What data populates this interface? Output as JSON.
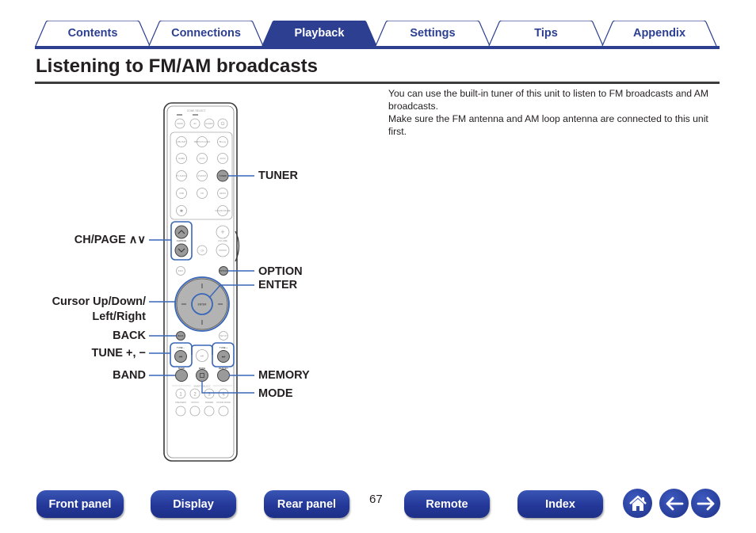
{
  "tabs": [
    {
      "label": "Contents",
      "active": false
    },
    {
      "label": "Connections",
      "active": false
    },
    {
      "label": "Playback",
      "active": true
    },
    {
      "label": "Settings",
      "active": false
    },
    {
      "label": "Tips",
      "active": false
    },
    {
      "label": "Appendix",
      "active": false
    }
  ],
  "page": {
    "title": "Listening to FM/AM broadcasts",
    "intro": [
      "You can use the built-in tuner of this unit to listen to FM broadcasts and AM broadcasts.",
      "Make sure the FM antenna and AM loop antenna are connected to this unit first."
    ],
    "number": "67"
  },
  "remote": {
    "callouts_left": {
      "ch_page": "CH/PAGE ∧∨",
      "cursor_line1": "Cursor Up/Down/",
      "cursor_line2": "Left/Right",
      "back": "BACK",
      "tune": "TUNE +, −",
      "band": "BAND"
    },
    "callouts_right": {
      "tuner": "TUNER",
      "option": "OPTION",
      "enter": "ENTER",
      "memory": "MEMORY",
      "mode": "MODE"
    },
    "small_labels": {
      "zone_select": "ZONE SELECT",
      "main": "MAIN",
      "z2": "Z2",
      "sleep": "SLEEP",
      "cbl_sat": "CBL/SAT",
      "media_player": "MEDIA PLAYER",
      "bluray": "Blu-ray",
      "game": "GAME",
      "aux1": "AUX1",
      "aux2": "AUX2",
      "tv_audio": "TV AUDIO",
      "phono": "PHONO",
      "tuner": "TUNER",
      "usb": "USB",
      "cd": "CD",
      "heos": "HEOS",
      "bluetooth": "✱",
      "sound_mode": "SOUND MODE",
      "ch_page": "CH/PAGE",
      "volume": "VOLUME",
      "mute": "◁×",
      "info": "INFO",
      "option": "OPTION",
      "enter": "ENTER",
      "back": "BACK",
      "setup": "SETUP",
      "tune_minus": "TUNE −",
      "tune_plus": "TUNE +",
      "band": "BAND",
      "mode": "MODE",
      "memory": "MEMORY",
      "smart_select": "SMART SELECT",
      "speakers": "SPEAKERS",
      "status": "STATUS",
      "dimmer": "DIMMER",
      "sound_mode2": "SOUND MODE",
      "one": "1",
      "two": "2",
      "three": "3",
      "four": "4"
    }
  },
  "bottom_nav": {
    "front_panel": "Front panel",
    "display": "Display",
    "rear_panel": "Rear panel",
    "remote": "Remote",
    "index": "Index",
    "home_icon": "home-icon",
    "back_icon": "arrow-left-icon",
    "forward_icon": "arrow-right-icon"
  },
  "colors": {
    "brand_blue": "#2c3f91",
    "callout_line": "#3a67b8",
    "highlight_button": "#9a9a9a"
  }
}
